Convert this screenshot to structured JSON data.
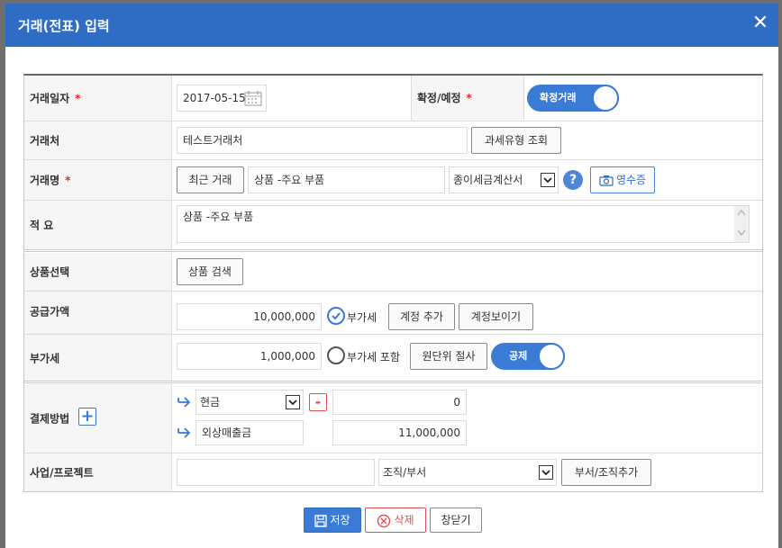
{
  "dialog": {
    "title": "거래(전표) 입력",
    "close": "✕"
  },
  "form": {
    "date": {
      "label": "거래일자",
      "required": "*",
      "value": "2017-05-15"
    },
    "confirm": {
      "label": "확정/예정",
      "required": "*",
      "toggle_label": "확정거래",
      "on": true
    },
    "client": {
      "label": "거래처",
      "value": "테스트거래처",
      "button": "과세유형 조회"
    },
    "name": {
      "label": "거래명",
      "required": "*",
      "recent_button": "최근 거래",
      "value": "상품 -주요 부품",
      "doc_type": "종이세금계산서",
      "help": "?",
      "receipt_button": "영수증"
    },
    "summary": {
      "label": "적 요",
      "value": "상품 -주요 부품"
    },
    "product": {
      "label": "상품선택",
      "button": "상품 검색"
    },
    "supply": {
      "label": "공급가액",
      "value": "10,000,000",
      "vat_check": "부가세",
      "vat_checked": true,
      "add_account": "계정 추가",
      "show_account": "계정보이기"
    },
    "vat": {
      "label": "부가세",
      "value": "1,000,000",
      "vat_included": "부가세 포함",
      "vat_included_checked": false,
      "round_button": "원단위 절사",
      "toggle_label": "공제",
      "on": true
    },
    "payment": {
      "label": "결제방법",
      "add": "+",
      "methods": [
        {
          "type": "현금",
          "amount": "0",
          "remove": "-"
        },
        {
          "type": "외상매출금",
          "amount": "11,000,000"
        }
      ]
    },
    "project": {
      "label": "사업/프로젝트",
      "value": "",
      "org_select": "조직/부서",
      "org_add": "부서/조직추가"
    }
  },
  "footer": {
    "save": "저장",
    "delete": "삭제",
    "close": "창닫기"
  },
  "colors": {
    "header": "#2f6dc4",
    "toggle": "#3a7bd5",
    "required": "#e22222",
    "delete": "#e05050"
  }
}
